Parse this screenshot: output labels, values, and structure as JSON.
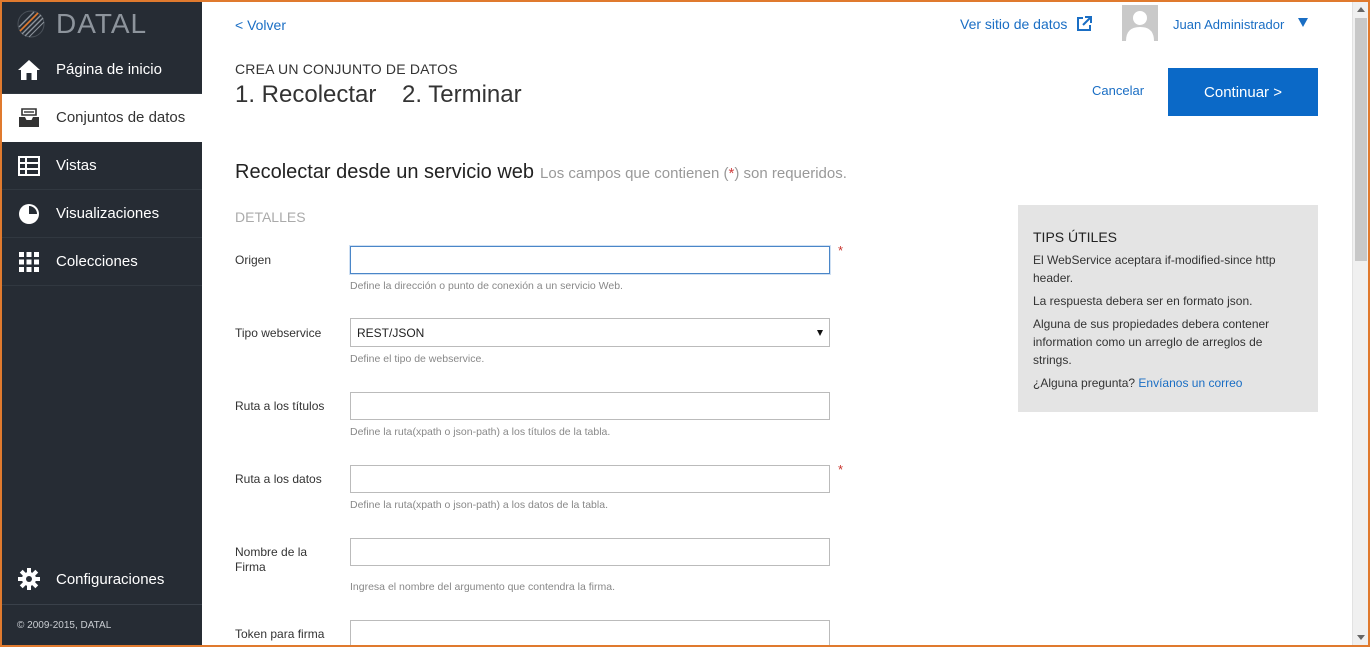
{
  "brand": {
    "name": "DATAL"
  },
  "sidebar": {
    "items": [
      {
        "label": "Página de inicio",
        "icon": "home-icon"
      },
      {
        "label": "Conjuntos de datos",
        "icon": "inbox-icon"
      },
      {
        "label": "Vistas",
        "icon": "table-icon"
      },
      {
        "label": "Visualizaciones",
        "icon": "pie-chart-icon"
      },
      {
        "label": "Colecciones",
        "icon": "grid-icon"
      }
    ],
    "active_index": 1,
    "settings_label": "Configuraciones",
    "copyright": "© 2009-2015, DATAL"
  },
  "header": {
    "back_label": "< Volver",
    "site_link_label": "Ver sitio de datos",
    "user_name": "Juan Administrador"
  },
  "wizard": {
    "title": "CREA UN CONJUNTO DE DATOS",
    "steps": [
      "1. Recolectar",
      "2. Terminar"
    ],
    "cancel_label": "Cancelar",
    "continue_label": "Continuar >"
  },
  "form": {
    "heading": "Recolectar desde un servicio web",
    "subheading_pre": "Los campos que contienen (",
    "subheading_star": "*",
    "subheading_post": ") son requeridos.",
    "section_label": "DETALLES",
    "fields": [
      {
        "label": "Origen",
        "value": "",
        "help": "Define la dirección o punto de conexión a un servicio Web.",
        "required": true
      },
      {
        "label": "Tipo webservice",
        "value": "REST/JSON",
        "help": "Define el tipo de webservice.",
        "required": false
      },
      {
        "label": "Ruta a los títulos",
        "value": "",
        "help": "Define la ruta(xpath o json-path) a los títulos de la tabla.",
        "required": false
      },
      {
        "label": "Ruta a los datos",
        "value": "",
        "help": "Define la ruta(xpath o json-path) a los datos de la tabla.",
        "required": true
      },
      {
        "label": "Nombre de la Firma",
        "value": "",
        "help": "Ingresa el nombre del argumento que contendra la firma.",
        "required": false
      },
      {
        "label": "Token para firma",
        "value": "",
        "help": "",
        "required": false
      }
    ],
    "required_mark": "*"
  },
  "tips": {
    "title": "TIPS ÚTILES",
    "items": [
      "El WebService aceptara if-modified-since http header.",
      "La respuesta debera ser en formato json.",
      "Alguna de sus propiedades debera contener information como un arreglo de arreglos de strings."
    ],
    "question": "¿Alguna pregunta?",
    "contact_link": "Envíanos un correo"
  },
  "colors": {
    "sidebar_bg": "#262c34",
    "accent": "#0b69c7",
    "link": "#1a6ec4",
    "required": "#c8322b",
    "window_border": "#e07a2e"
  }
}
